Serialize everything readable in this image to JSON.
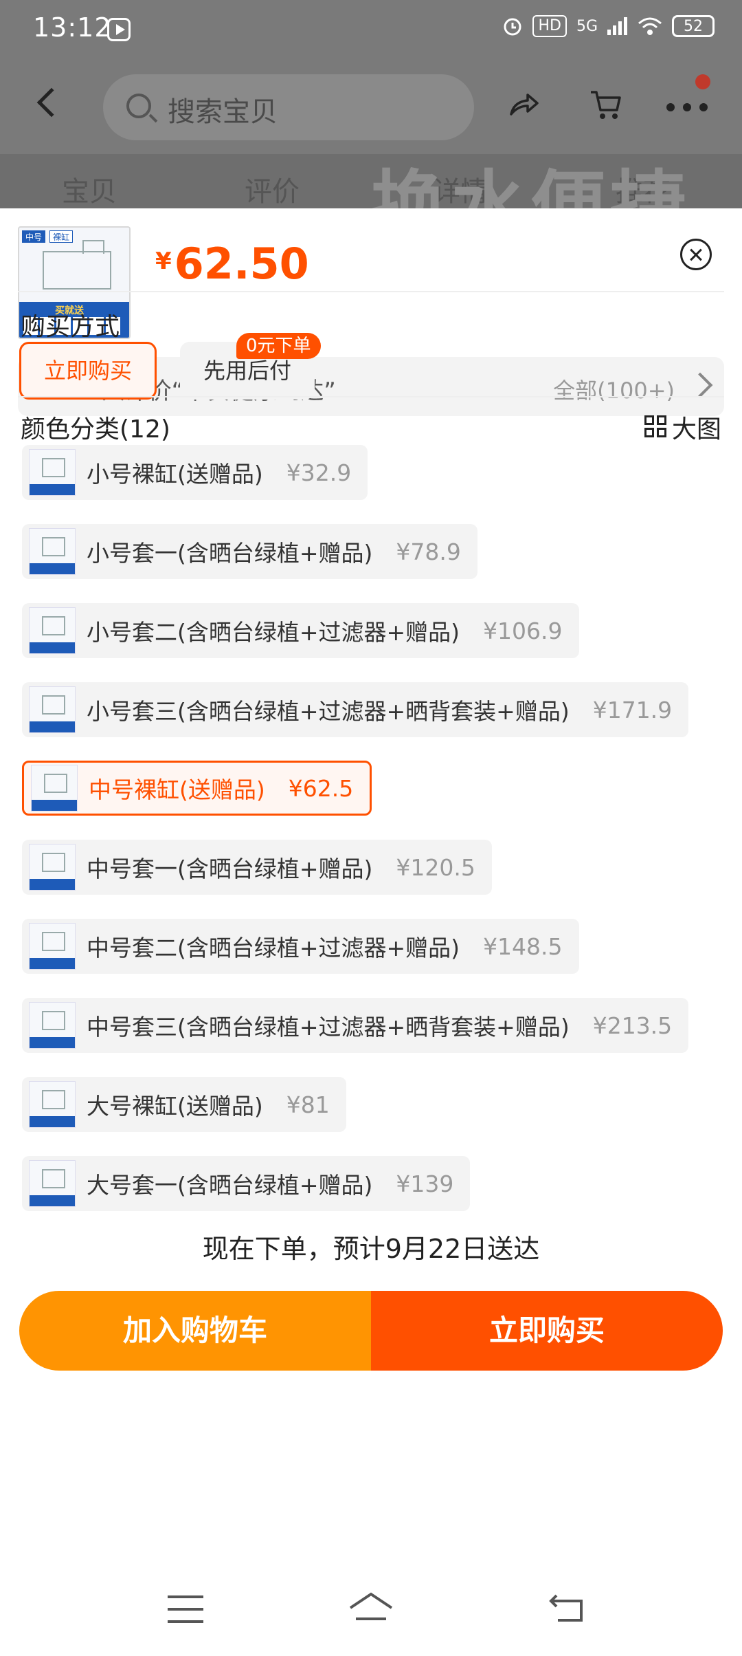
{
  "status_bar": {
    "time": "13:12",
    "hd": "HD",
    "network": "5G",
    "battery": "52"
  },
  "nav": {
    "search_placeholder": "搜索宝贝"
  },
  "background_tabs": [
    "宝贝",
    "评价",
    "详情",
    "推荐"
  ],
  "background_banner": "换水便捷",
  "product": {
    "thumb_tag_size": "中号",
    "thumb_tag_type": "裸缸",
    "thumb_strip_label": "买就送",
    "price_symbol": "¥",
    "price": "62.50"
  },
  "review": {
    "text": "4人评价“平安健康到达”",
    "all_label": "全部(100+)"
  },
  "purchase": {
    "title": "购买方式",
    "buy_now": "立即购买",
    "pay_later": "先用后付",
    "badge": "0元下单"
  },
  "colors_section": {
    "title": "颜色分类(12)",
    "big_image_label": "大图",
    "options": [
      {
        "name": "小号裸缸(送赠品)",
        "price": "¥32.9",
        "selected": false
      },
      {
        "name": "小号套一(含晒台绿植+赠品)",
        "price": "¥78.9",
        "selected": false
      },
      {
        "name": "小号套二(含晒台绿植+过滤器+赠品)",
        "price": "¥106.9",
        "selected": false
      },
      {
        "name": "小号套三(含晒台绿植+过滤器+晒背套装+赠品)",
        "price": "¥171.9",
        "selected": false
      },
      {
        "name": "中号裸缸(送赠品)",
        "price": "¥62.5",
        "selected": true
      },
      {
        "name": "中号套一(含晒台绿植+赠品)",
        "price": "¥120.5",
        "selected": false
      },
      {
        "name": "中号套二(含晒台绿植+过滤器+赠品)",
        "price": "¥148.5",
        "selected": false
      },
      {
        "name": "中号套三(含晒台绿植+过滤器+晒背套装+赠品)",
        "price": "¥213.5",
        "selected": false
      },
      {
        "name": "大号裸缸(送赠品)",
        "price": "¥81",
        "selected": false
      },
      {
        "name": "大号套一(含晒台绿植+赠品)",
        "price": "¥139",
        "selected": false
      }
    ]
  },
  "footer": {
    "delivery_text": "现在下单，预计9月22日送达",
    "add_to_cart": "加入购物车",
    "buy_now": "立即购买"
  },
  "colors": {
    "accent": "#ff5000",
    "cart_button": "#ff9402",
    "buy_button": "#ff5000"
  }
}
